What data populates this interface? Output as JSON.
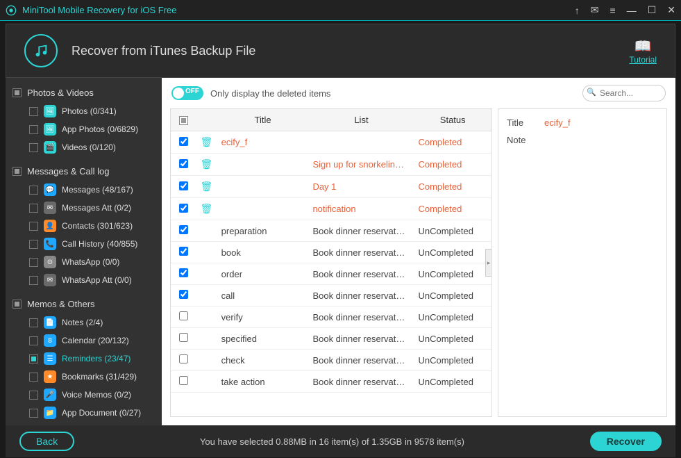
{
  "app_title": "MiniTool Mobile Recovery for iOS Free",
  "header_title": "Recover from iTunes Backup File",
  "tutorial_label": "Tutorial",
  "toggle_state": "OFF",
  "toggle_text": "Only display the deleted items",
  "search_placeholder": "Search...",
  "sidebar": {
    "groups": [
      {
        "title": "Photos & Videos",
        "items": [
          {
            "icon": "🖼",
            "color": "#2dd4d4",
            "label": "Photos (0/341)"
          },
          {
            "icon": "🖼",
            "color": "#2dd4d4",
            "label": "App Photos (0/6829)"
          },
          {
            "icon": "🎬",
            "color": "#2dd4d4",
            "label": "Videos (0/120)"
          }
        ]
      },
      {
        "title": "Messages & Call log",
        "items": [
          {
            "icon": "💬",
            "color": "#1ea8ff",
            "label": "Messages (48/167)"
          },
          {
            "icon": "✉",
            "color": "#6a6a6a",
            "label": "Messages Att (0/2)"
          },
          {
            "icon": "👤",
            "color": "#ff8a2a",
            "label": "Contacts (301/623)"
          },
          {
            "icon": "📞",
            "color": "#1ea8ff",
            "label": "Call History (40/855)"
          },
          {
            "icon": "⊙",
            "color": "#888",
            "label": "WhatsApp (0/0)"
          },
          {
            "icon": "✉",
            "color": "#6a6a6a",
            "label": "WhatsApp Att (0/0)"
          }
        ]
      },
      {
        "title": "Memos & Others",
        "items": [
          {
            "icon": "📄",
            "color": "#1ea8ff",
            "label": "Notes (2/4)"
          },
          {
            "icon": "8",
            "color": "#1ea8ff",
            "label": "Calendar (20/132)"
          },
          {
            "icon": "☰",
            "color": "#1ea8ff",
            "label": "Reminders (23/47)",
            "active": true
          },
          {
            "icon": "★",
            "color": "#ff8a2a",
            "label": "Bookmarks (31/429)"
          },
          {
            "icon": "🎤",
            "color": "#1ea8ff",
            "label": "Voice Memos (0/2)"
          },
          {
            "icon": "📁",
            "color": "#1ea8ff",
            "label": "App Document (0/27)"
          }
        ]
      }
    ]
  },
  "table": {
    "headers": {
      "title": "Title",
      "list": "List",
      "status": "Status"
    },
    "rows": [
      {
        "checked": true,
        "deleted": true,
        "selected": true,
        "title": "ecify_f",
        "list": "",
        "status": "Completed"
      },
      {
        "checked": true,
        "deleted": true,
        "title": "",
        "list": "Sign up for snorkelin…",
        "status": "Completed"
      },
      {
        "checked": true,
        "deleted": true,
        "title": "",
        "list": "Day 1",
        "status": "Completed"
      },
      {
        "checked": true,
        "deleted": true,
        "title": "",
        "list": "notification",
        "status": "Completed"
      },
      {
        "checked": true,
        "title": "preparation",
        "list": "Book dinner reservat…",
        "status": "UnCompleted"
      },
      {
        "checked": true,
        "title": "book",
        "list": "Book dinner reservat…",
        "status": "UnCompleted"
      },
      {
        "checked": true,
        "title": "order",
        "list": "Book dinner reservat…",
        "status": "UnCompleted"
      },
      {
        "checked": true,
        "title": "call",
        "list": "Book dinner reservat…",
        "status": "UnCompleted"
      },
      {
        "checked": false,
        "title": "verify",
        "list": "Book dinner reservat…",
        "status": "UnCompleted"
      },
      {
        "checked": false,
        "title": "specified",
        "list": "Book dinner reservat…",
        "status": "UnCompleted"
      },
      {
        "checked": false,
        "title": "check",
        "list": "Book dinner reservat…",
        "status": "UnCompleted"
      },
      {
        "checked": false,
        "title": "take action",
        "list": "Book dinner reservat…",
        "status": "UnCompleted"
      }
    ]
  },
  "detail": {
    "title_label": "Title",
    "title_value": "ecify_f",
    "note_label": "Note"
  },
  "footer": {
    "back": "Back",
    "status": "You have selected 0.88MB in 16 item(s) of 1.35GB in 9578 item(s)",
    "recover": "Recover"
  }
}
